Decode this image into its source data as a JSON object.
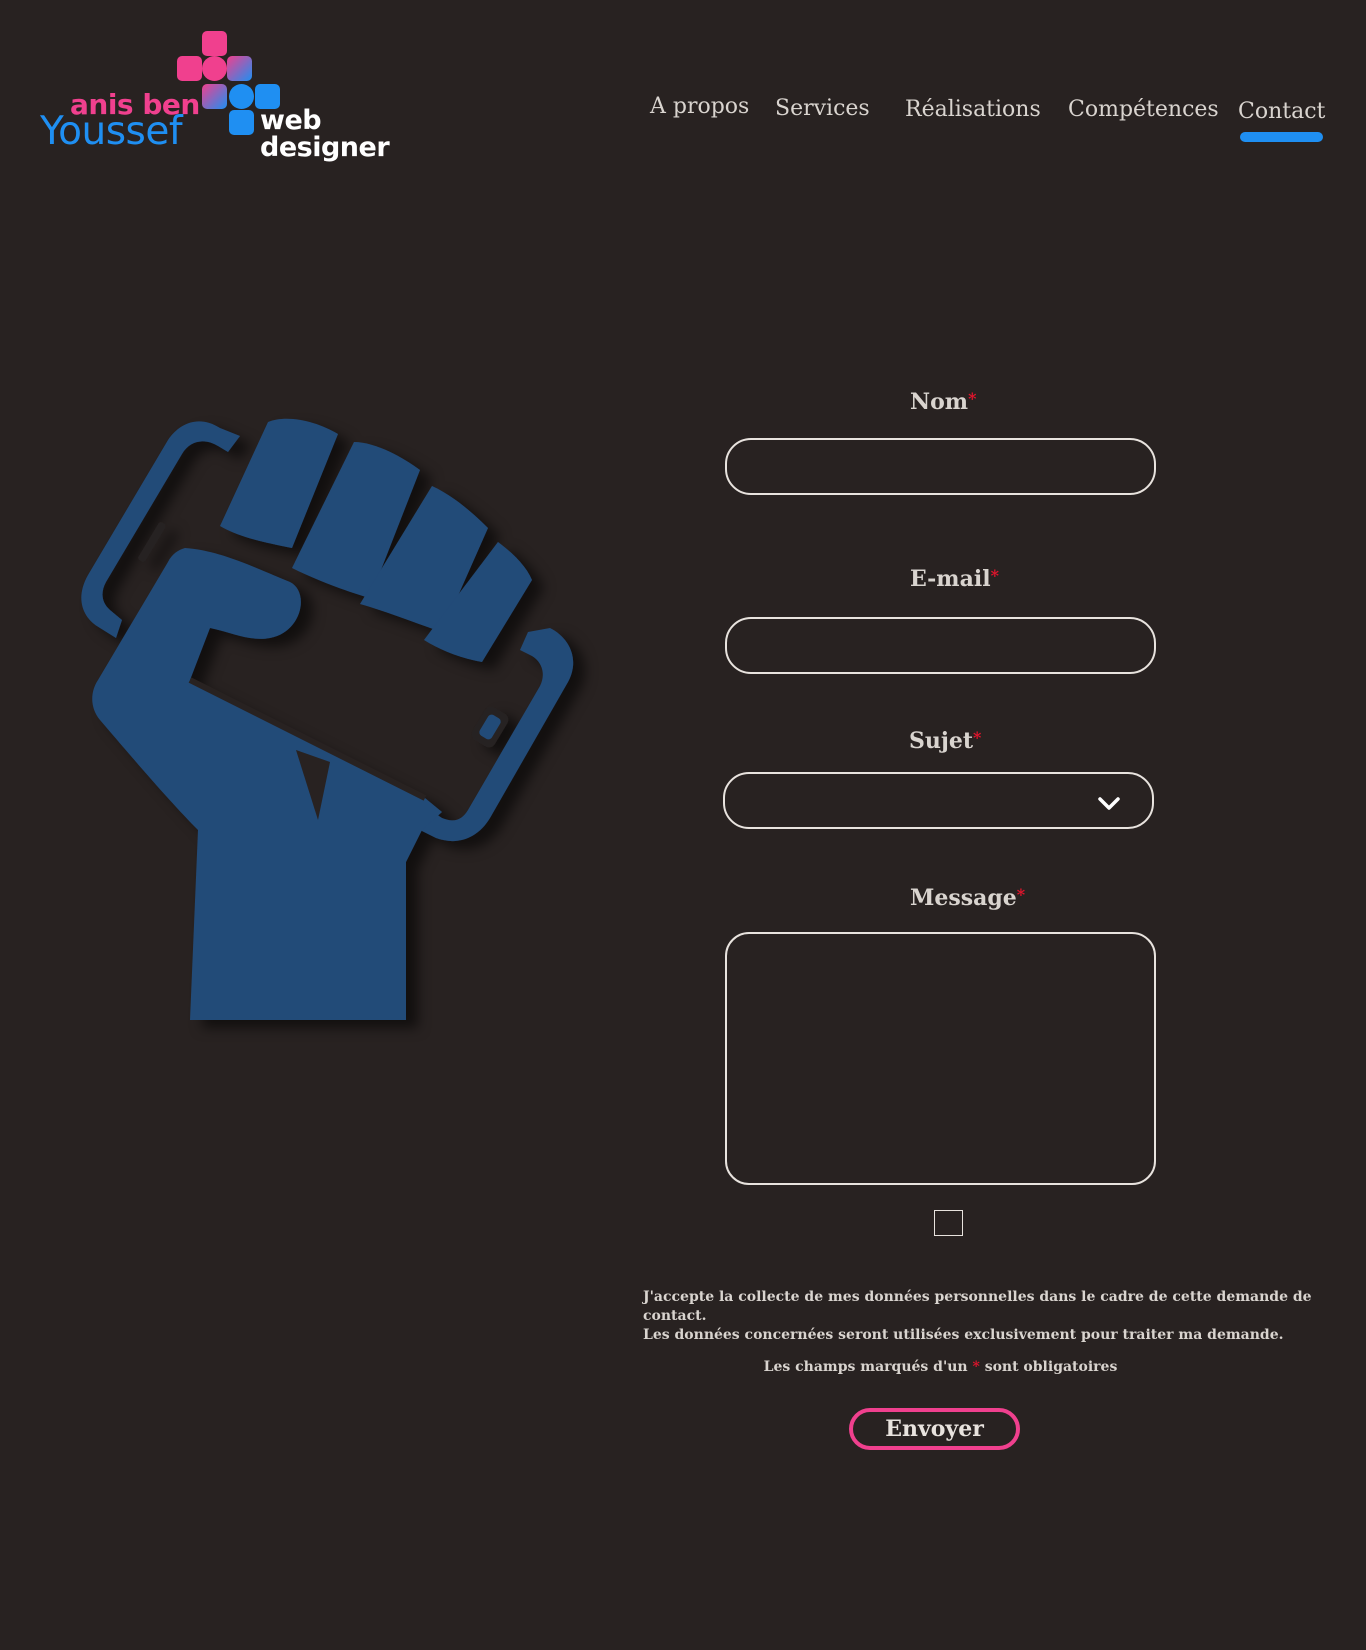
{
  "logo": {
    "first_name": "anis ben",
    "last_name": "Youssef",
    "role": "web designer",
    "colors": {
      "pink": "#f0408e",
      "blue": "#1f8ff2"
    }
  },
  "nav": {
    "items": [
      {
        "label": "A propos"
      },
      {
        "label": "Services"
      },
      {
        "label": "Réalisations"
      },
      {
        "label": "Compétences"
      },
      {
        "label": "Contact",
        "active": true
      }
    ],
    "active_color": "#1f8ff2"
  },
  "illustration": {
    "icon": "fist-holding-smartphone-icon",
    "color": "#234b78"
  },
  "form": {
    "required_marker": "*",
    "name": {
      "label": "Nom",
      "value": "",
      "placeholder": ""
    },
    "email": {
      "label": "E-mail",
      "value": "",
      "placeholder": ""
    },
    "subject": {
      "label": "Sujet",
      "selected": ""
    },
    "message": {
      "label": "Message",
      "value": "",
      "placeholder": ""
    },
    "consent": {
      "checked": false,
      "line1": "J'accepte la collecte de mes données personnelles dans le cadre de cette demande de contact.",
      "line2": "Les données concernées seront utilisées exclusivement pour traiter ma demande."
    },
    "required_note": {
      "before": "Les champs marqués d'un",
      "marker": "*",
      "after": "sont obligatoires"
    },
    "submit_label": "Envoyer",
    "submit_border_color": "#f0408e",
    "required_color": "#e1142c"
  }
}
